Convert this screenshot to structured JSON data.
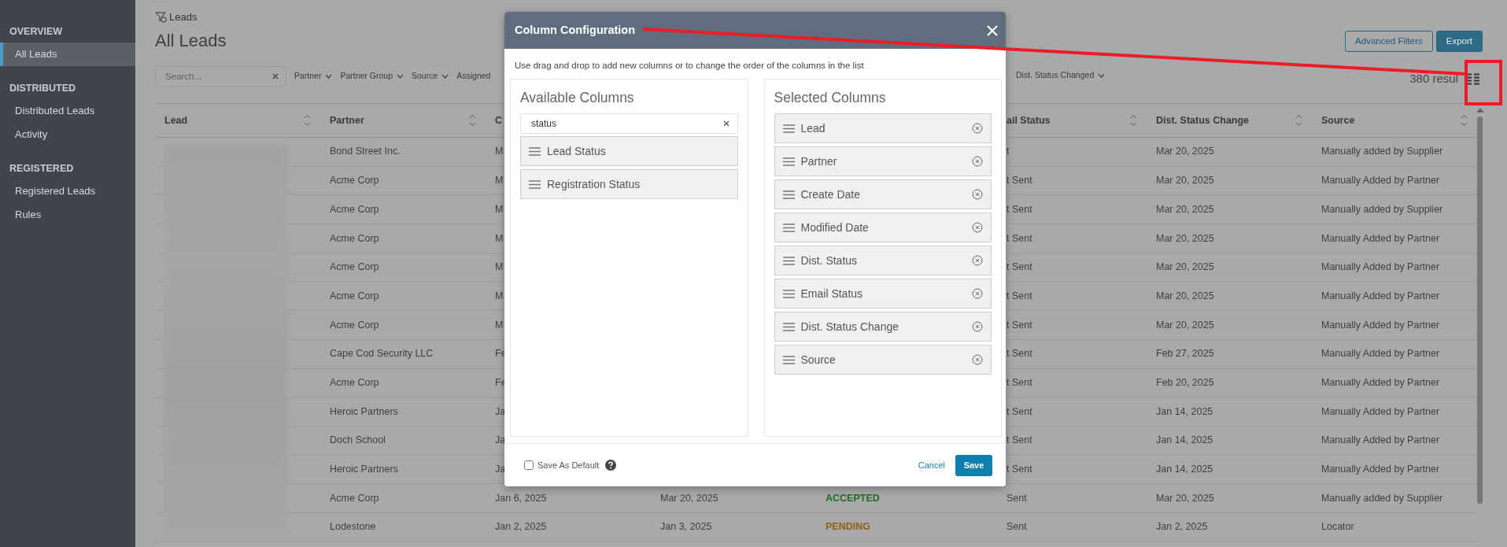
{
  "sidebar": {
    "sections": [
      {
        "title": "OVERVIEW",
        "items": [
          {
            "label": "All Leads",
            "selected": true
          }
        ]
      },
      {
        "title": "DISTRIBUTED",
        "items": [
          {
            "label": "Distributed Leads",
            "selected": false
          },
          {
            "label": "Activity",
            "selected": false
          }
        ]
      },
      {
        "title": "REGISTERED",
        "items": [
          {
            "label": "Registered Leads",
            "selected": false
          },
          {
            "label": "Rules",
            "selected": false
          }
        ]
      }
    ]
  },
  "page": {
    "breadcrumb": "Leads",
    "title": "All Leads",
    "buttons": [
      {
        "label": "Advanced Filters",
        "kind": "outline"
      },
      {
        "label": "Export",
        "kind": "solid"
      }
    ]
  },
  "filters": {
    "search": {
      "placeholder": "Search..."
    },
    "dropdowns": [
      {
        "label": "Partner",
        "chevron": true
      },
      {
        "label": "Partner Group",
        "chevron": true
      },
      {
        "label": "Source",
        "chevron": true
      },
      {
        "label": "Assigned",
        "chevron": false
      }
    ],
    "dropdowns_right": [
      {
        "label": "Dist. Status Changed",
        "chevron": true
      }
    ],
    "result_count": "380 resul"
  },
  "table": {
    "columns_left": [
      {
        "label": "Lead",
        "sort_icon": true
      },
      {
        "label": "Partner",
        "sort_icon": true
      },
      {
        "label": "C",
        "sort_icon": false
      }
    ],
    "columns_right": [
      {
        "label": "ail Status",
        "sort_icon": true
      },
      {
        "label": "Dist. Status Change",
        "sort_icon": true
      },
      {
        "label": "Source",
        "sort_icon": true
      }
    ],
    "rows": [
      {
        "partner": "Bond Street Inc.",
        "create_date": "M",
        "email_status": "t",
        "dist_status_change": "Mar 20, 2025",
        "source": "Manually added by Supplier"
      },
      {
        "partner": "Acme Corp",
        "create_date": "M",
        "email_status": "t Sent",
        "dist_status_change": "Mar 20, 2025",
        "source": "Manually Added by Partner"
      },
      {
        "partner": "Acme Corp",
        "create_date": "M",
        "email_status": "t Sent",
        "dist_status_change": "Mar 20, 2025",
        "source": "Manually added by Supplier"
      },
      {
        "partner": "Acme Corp",
        "create_date": "M",
        "email_status": "t Sent",
        "dist_status_change": "Mar 20, 2025",
        "source": "Manually Added by Partner"
      },
      {
        "partner": "Acme Corp",
        "create_date": "M",
        "email_status": "t Sent",
        "dist_status_change": "Mar 20, 2025",
        "source": "Manually Added by Partner"
      },
      {
        "partner": "Acme Corp",
        "create_date": "M",
        "email_status": "t Sent",
        "dist_status_change": "Mar 20, 2025",
        "source": "Manually Added by Partner"
      },
      {
        "partner": "Acme Corp",
        "create_date": "M",
        "email_status": "t Sent",
        "dist_status_change": "Mar 20, 2025",
        "source": "Manually Added by Partner"
      },
      {
        "partner": "Cape Cod Security LLC",
        "create_date": "Fe",
        "email_status": "t Sent",
        "dist_status_change": "Feb 27, 2025",
        "source": "Manually Added by Partner"
      },
      {
        "partner": "Acme Corp",
        "create_date": "Fe",
        "email_status": "t Sent",
        "dist_status_change": "Feb 20, 2025",
        "source": "Manually Added by Partner"
      },
      {
        "partner": "Heroic Partners",
        "create_date": "Ja",
        "email_status": "t Sent",
        "dist_status_change": "Jan 14, 2025",
        "source": "Manually Added by Partner"
      },
      {
        "partner": "Doch School",
        "create_date": "Ja",
        "email_status": "t Sent",
        "dist_status_change": "Jan 14, 2025",
        "source": "Manually Added by Partner"
      },
      {
        "partner": "Heroic Partners",
        "create_date": "Ja",
        "email_status": "t Sent",
        "dist_status_change": "Jan 14, 2025",
        "source": "Manually Added by Partner"
      },
      {
        "partner": "Acme Corp",
        "create_date": "Jan 6, 2025",
        "modified_date": "Mar 20, 2025",
        "dist_status": {
          "text": "ACCEPTED",
          "color": "#1f6e26"
        },
        "email_status": "Sent",
        "dist_status_change": "Mar 20, 2025",
        "source": "Manually added by Supplier"
      },
      {
        "partner": "Lodestone",
        "create_date": "Jan 2, 2025",
        "modified_date": "Jan 3, 2025",
        "dist_status": {
          "text": "PENDING",
          "color": "#8f5f12"
        },
        "email_status": "Sent",
        "dist_status_change": "Jan 2, 2025",
        "source": "Locator"
      }
    ]
  },
  "modal": {
    "title": "Column Configuration",
    "description": "Use drag and drop to add new columns or to change the order of the columns in the list",
    "available": {
      "title": "Available Columns",
      "search_value": "status",
      "items": [
        "Lead Status",
        "Registration Status"
      ]
    },
    "selected": {
      "title": "Selected Columns",
      "items": [
        "Lead",
        "Partner",
        "Create Date",
        "Modified Date",
        "Dist. Status",
        "Email Status",
        "Dist. Status Change",
        "Source"
      ]
    },
    "save_as_default": {
      "label": "Save As Default",
      "checked": false
    },
    "buttons": [
      {
        "label": "Cancel",
        "kind": "link"
      },
      {
        "label": "Save",
        "kind": "solid"
      }
    ]
  }
}
